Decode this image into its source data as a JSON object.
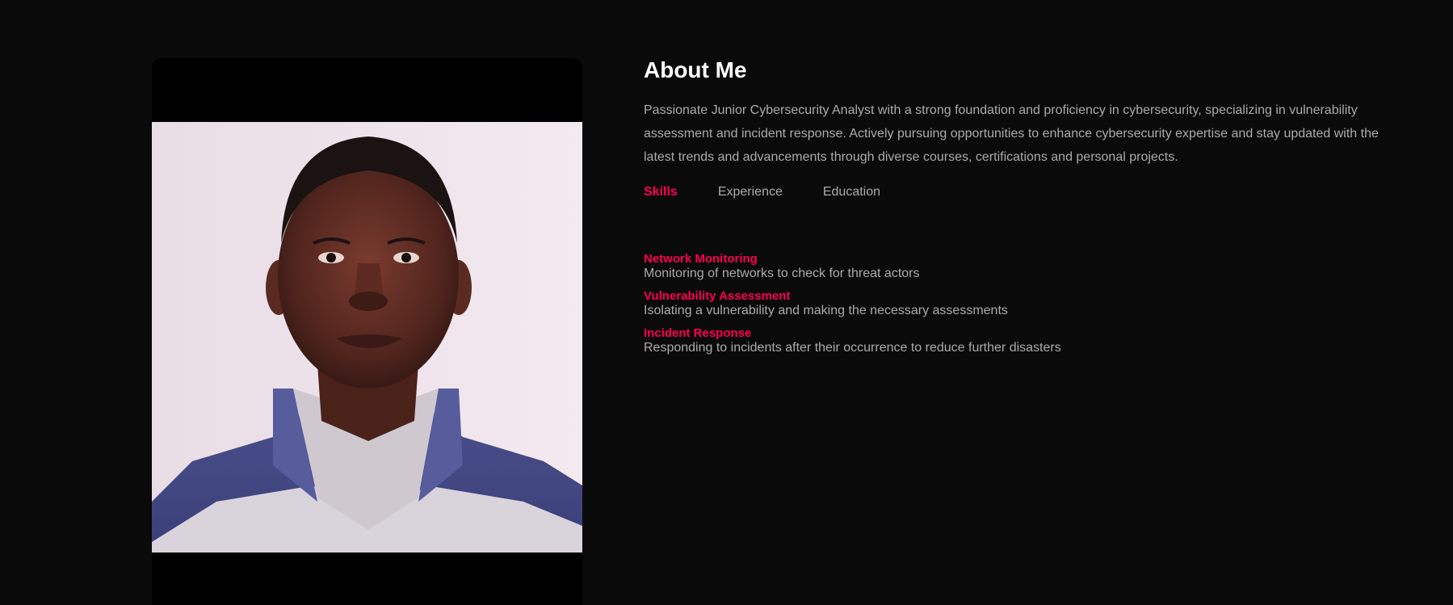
{
  "about": {
    "title": "About Me",
    "bio": "Passionate Junior Cybersecurity Analyst with a strong foundation and proficiency in cybersecurity, specializing in vulnerability assessment and incident response. Actively pursuing opportunities to enhance cybersecurity expertise and stay updated with the latest trends and advancements through diverse courses, certifications and personal projects."
  },
  "tabs": [
    {
      "label": "Skills",
      "active": true
    },
    {
      "label": "Experience",
      "active": false
    },
    {
      "label": "Education",
      "active": false
    }
  ],
  "skills": [
    {
      "name": "Network Monitoring",
      "description": "Monitoring of networks to check for threat actors"
    },
    {
      "name": "Vulnerability Assessment",
      "description": "Isolating a vulnerability and making the necessary assessments"
    },
    {
      "name": "Incident Response",
      "description": "Responding to incidents after their occurrence to reduce further disasters"
    }
  ],
  "colors": {
    "background": "#0a0a0b",
    "accent": "#ff004f",
    "text_muted": "#ababab",
    "heading": "#ffffff"
  }
}
